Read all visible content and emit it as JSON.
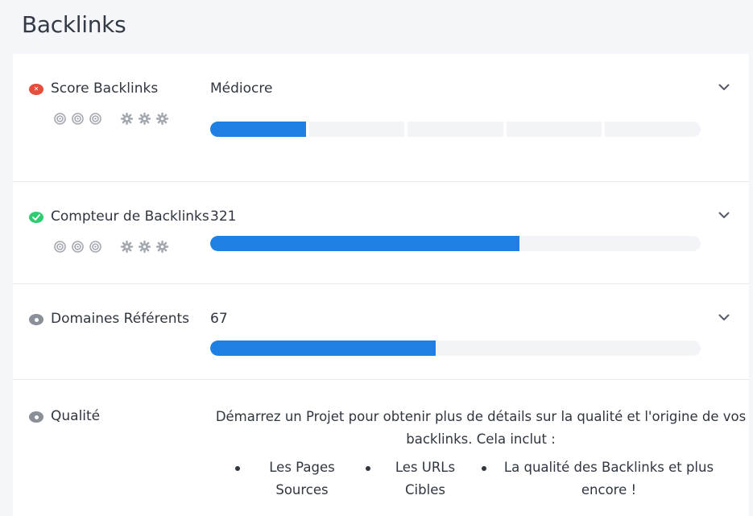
{
  "page": {
    "title": "Backlinks"
  },
  "rows": {
    "score": {
      "label": "Score Backlinks",
      "value": "Médiocre",
      "status": "error",
      "filled_segments": 1,
      "total_segments": 5
    },
    "count": {
      "label": "Compteur de Backlinks",
      "value": "321",
      "status": "ok",
      "progress": 0.63
    },
    "domains": {
      "label": "Domaines Référents",
      "value": "67",
      "status": "neutral",
      "progress": 0.46
    },
    "quality": {
      "label": "Qualité",
      "status": "neutral",
      "description": "Démarrez un Projet pour obtenir plus de détails sur la qualité et l'origine de vos backlinks. Cela inclut :",
      "items": [
        "Les Pages Sources",
        "Les URLs Cibles",
        "La qualité des Backlinks et plus encore !"
      ]
    }
  },
  "icons": {
    "status_error": "close-icon",
    "status_ok": "check-icon",
    "status_neutral": "eye-icon",
    "target": "target-icon",
    "gear": "gear-icon",
    "chevron": "chevron-down-icon"
  },
  "colors": {
    "accent": "#1e80e3",
    "error": "#e74c3c",
    "ok": "#2ecc71",
    "neutral": "#8a8f98",
    "track": "#f3f4f8"
  }
}
